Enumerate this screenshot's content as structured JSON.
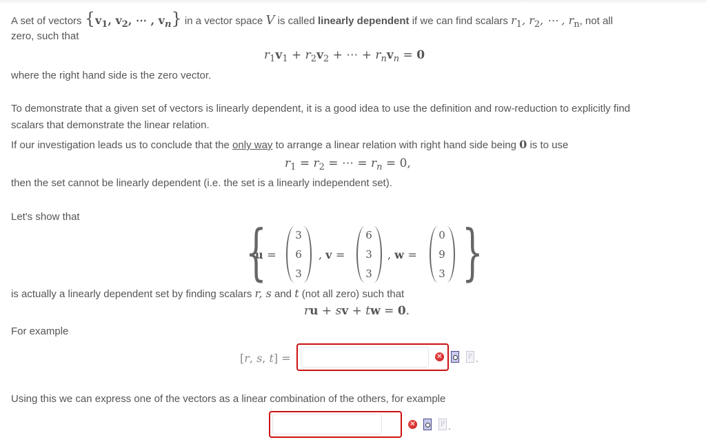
{
  "intro": {
    "p1_a": "A set of vectors ",
    "set_v": "v",
    "p1_b": " in a vector space ",
    "space": "V",
    "p1_c": " is called ",
    "bold_term": "linearly dependent",
    "p1_d": " if we can find scalars ",
    "p1_e": ", not all",
    "p1_line2": "zero, such that",
    "equation1": "r₁v₁ + r₂v₂ + ⋯ + rₙvₙ = 0",
    "p2": "where the right hand side is the zero vector."
  },
  "demo": {
    "p3_line1": "To demonstrate that a given set of vectors is linearly dependent, it is a good idea to use the definition and row-reduction to explicitly find",
    "p3_line2": "scalars that demonstrate the linear relation.",
    "p4_a": "If our investigation leads us to conclude that the ",
    "p4_underline": "only way",
    "p4_b": " to arrange a linear relation with right hand side being ",
    "p4_zero": "0",
    "p4_c": " is to use",
    "equation2": "r₁ = r₂ = ⋯ = rₙ = 0,",
    "p5": "then the set cannot be linearly dependent (i.e. the set is a linearly independent set)."
  },
  "problem": {
    "lets_show": "Let's show that",
    "vectors": [
      {
        "name": "u",
        "values": [
          "3",
          "6",
          "3"
        ]
      },
      {
        "name": "v",
        "values": [
          "6",
          "3",
          "3"
        ]
      },
      {
        "name": "w",
        "values": [
          "0",
          "9",
          "3"
        ]
      }
    ],
    "p6_a": "is actually a linearly dependent set by finding scalars ",
    "p6_rs": "r, s",
    "p6_b": " and ",
    "p6_t": "t",
    "p6_c": " (not all zero) such that",
    "equation3": "ru + sv + tw = 0.",
    "for_example": "For example",
    "answer1_label": "[r, s, t] =",
    "answer1_value": "",
    "using_this": "Using this we can express one of the vectors as a linear combination of the others, for example",
    "answer2_value": ""
  },
  "icons": {
    "error": "✕",
    "help": "P",
    "period": "."
  },
  "colors": {
    "error_border": "#cc1111",
    "text": "#555555"
  }
}
